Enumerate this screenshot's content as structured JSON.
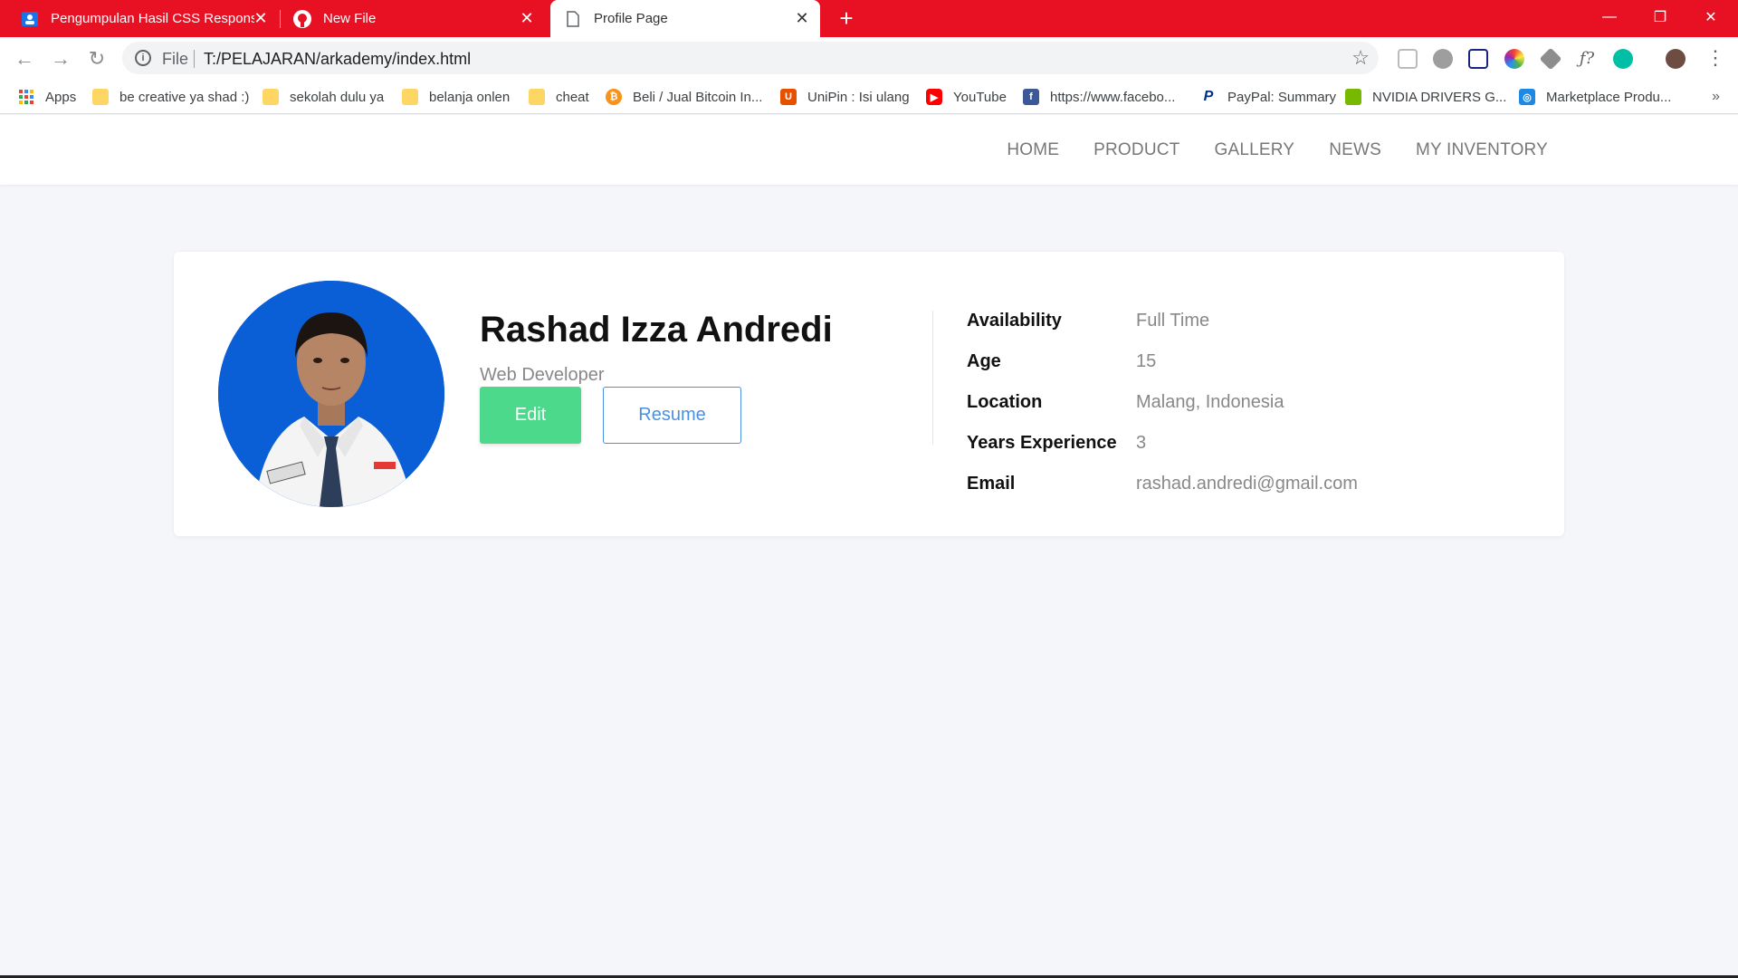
{
  "browser": {
    "tabs": [
      {
        "title": "Pengumpulan Hasil CSS Responsi",
        "favicon": "classroom-icon"
      },
      {
        "title": "New File",
        "favicon": "github-icon"
      },
      {
        "title": "Profile Page",
        "favicon": "page-icon"
      }
    ],
    "address": {
      "scheme": "File",
      "url": "T:/PELAJARAN/arkademy/index.html"
    },
    "bookmarks": [
      {
        "label": "Apps",
        "icon": "apps-grid-icon"
      },
      {
        "label": "be creative ya shad :)",
        "icon": "folder-icon"
      },
      {
        "label": "sekolah dulu ya",
        "icon": "folder-icon"
      },
      {
        "label": "belanja onlen",
        "icon": "folder-icon"
      },
      {
        "label": "cheat",
        "icon": "folder-icon"
      },
      {
        "label": "Beli / Jual Bitcoin In...",
        "icon": "bitcoin-icon"
      },
      {
        "label": "UniPin : Isi ulang",
        "icon": "unipin-icon"
      },
      {
        "label": "YouTube",
        "icon": "youtube-icon"
      },
      {
        "label": "https://www.facebo...",
        "icon": "facebook-icon"
      },
      {
        "label": "PayPal: Summary",
        "icon": "paypal-icon"
      },
      {
        "label": "NVIDIA DRIVERS G...",
        "icon": "nvidia-icon"
      },
      {
        "label": "Marketplace Produ...",
        "icon": "marketplace-icon"
      }
    ],
    "colors": {
      "tab_strip": "#e81123"
    }
  },
  "nav": {
    "items": [
      "HOME",
      "PRODUCT",
      "GALLERY",
      "NEWS",
      "MY INVENTORY"
    ]
  },
  "profile": {
    "name": "Rashad Izza Andredi",
    "role": "Web Developer",
    "edit_label": "Edit",
    "resume_label": "Resume",
    "details": [
      {
        "label": "Availability",
        "value": "Full Time"
      },
      {
        "label": "Age",
        "value": "15"
      },
      {
        "label": "Location",
        "value": "Malang, Indonesia"
      },
      {
        "label": "Years Experience",
        "value": "3"
      },
      {
        "label": "Email",
        "value": "rashad.andredi@gmail.com"
      }
    ],
    "colors": {
      "edit_button": "#4cd98c",
      "resume_border": "#4a90e2",
      "avatar_bg": "#0a5fd6"
    }
  }
}
